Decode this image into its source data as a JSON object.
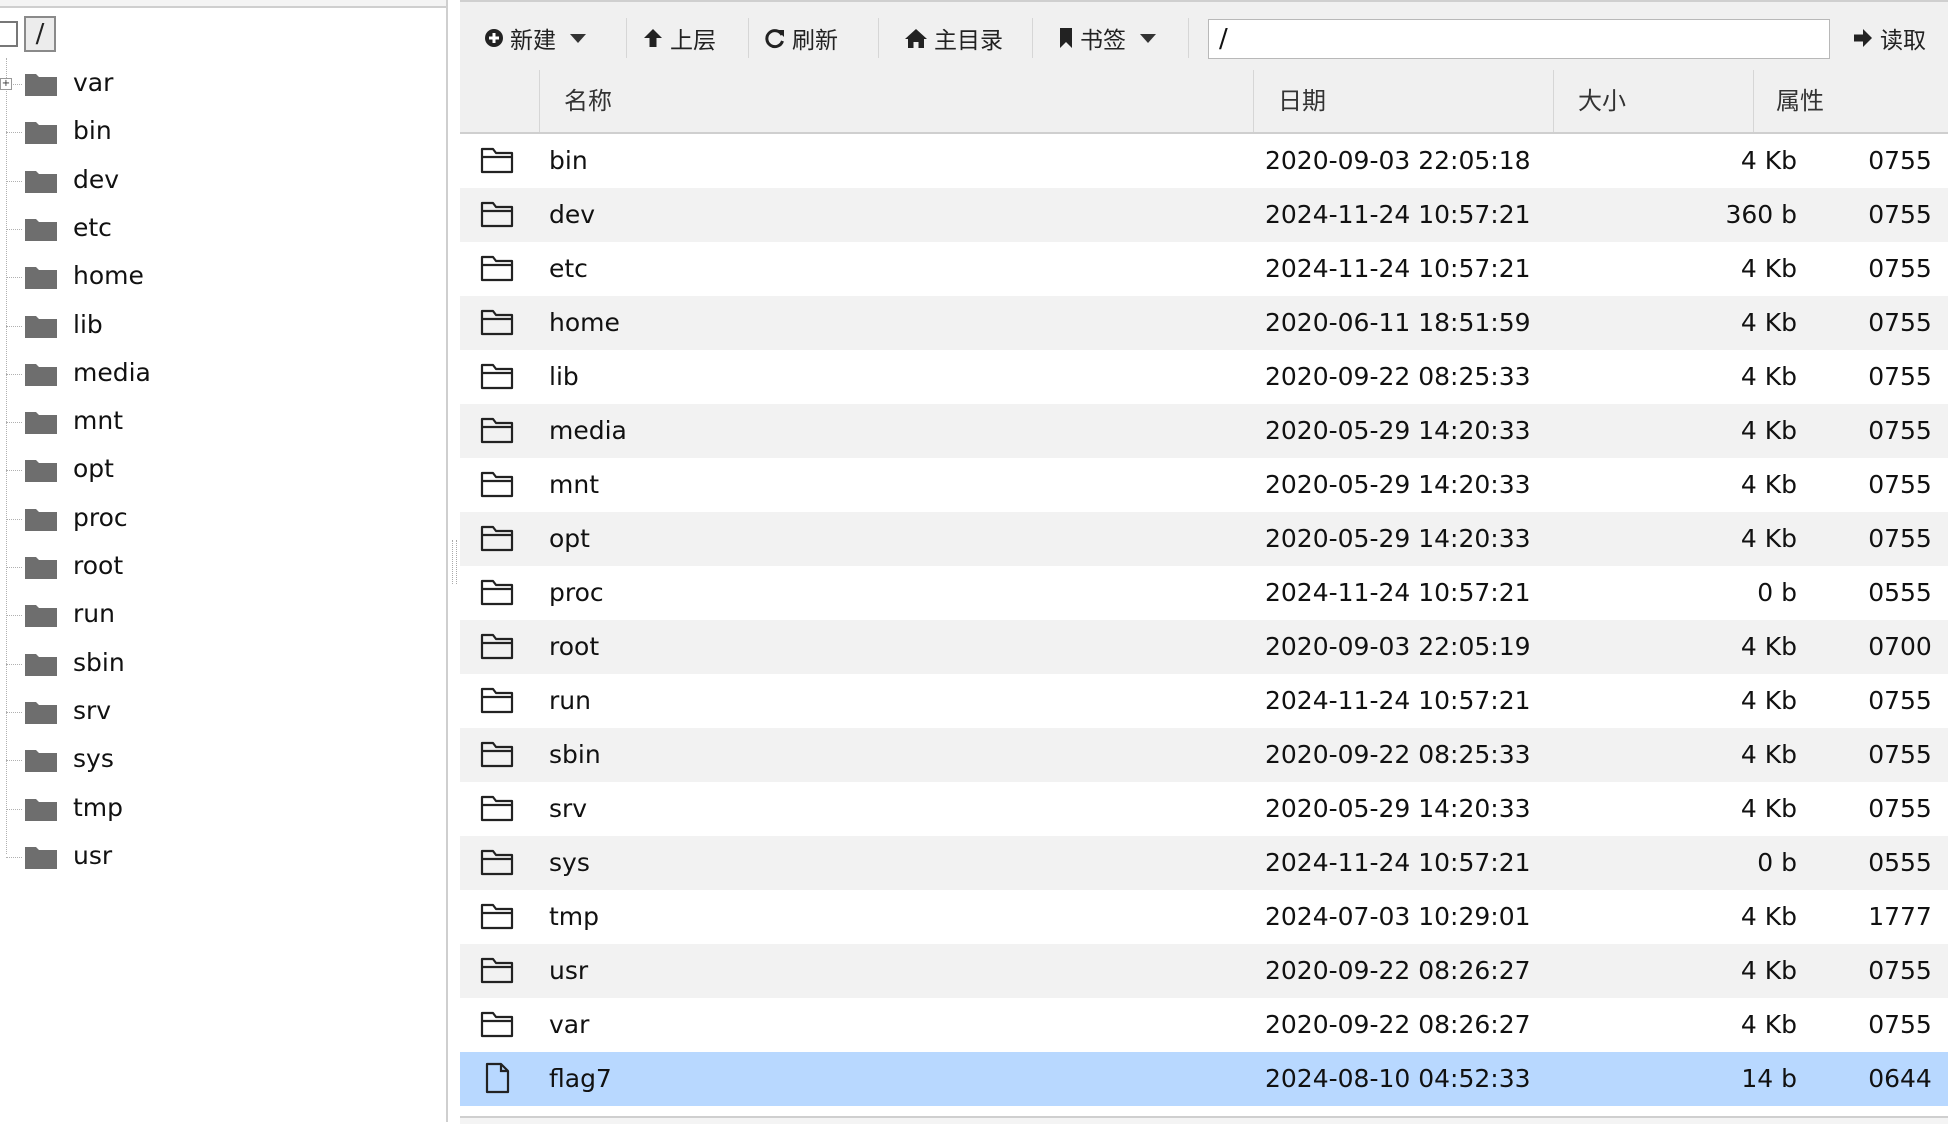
{
  "tree": {
    "root_label": "/",
    "items": [
      {
        "label": "var",
        "expandable": true
      },
      {
        "label": "bin"
      },
      {
        "label": "dev"
      },
      {
        "label": "etc"
      },
      {
        "label": "home"
      },
      {
        "label": "lib"
      },
      {
        "label": "media"
      },
      {
        "label": "mnt"
      },
      {
        "label": "opt"
      },
      {
        "label": "proc"
      },
      {
        "label": "root"
      },
      {
        "label": "run"
      },
      {
        "label": "sbin"
      },
      {
        "label": "srv"
      },
      {
        "label": "sys"
      },
      {
        "label": "tmp"
      },
      {
        "label": "usr"
      }
    ]
  },
  "toolbar": {
    "new_label": "新建",
    "up_label": "上层",
    "refresh_label": "刷新",
    "home_label": "主目录",
    "bookmark_label": "书签",
    "path_value": "/",
    "read_label": "读取"
  },
  "table": {
    "columns": {
      "name": "名称",
      "date": "日期",
      "size": "大小",
      "perm": "属性"
    },
    "rows": [
      {
        "type": "folder",
        "name": "bin",
        "date": "2020-09-03 22:05:18",
        "size": "4 Kb",
        "perm": "0755"
      },
      {
        "type": "folder",
        "name": "dev",
        "date": "2024-11-24 10:57:21",
        "size": "360 b",
        "perm": "0755"
      },
      {
        "type": "folder",
        "name": "etc",
        "date": "2024-11-24 10:57:21",
        "size": "4 Kb",
        "perm": "0755"
      },
      {
        "type": "folder",
        "name": "home",
        "date": "2020-06-11 18:51:59",
        "size": "4 Kb",
        "perm": "0755"
      },
      {
        "type": "folder",
        "name": "lib",
        "date": "2020-09-22 08:25:33",
        "size": "4 Kb",
        "perm": "0755"
      },
      {
        "type": "folder",
        "name": "media",
        "date": "2020-05-29 14:20:33",
        "size": "4 Kb",
        "perm": "0755"
      },
      {
        "type": "folder",
        "name": "mnt",
        "date": "2020-05-29 14:20:33",
        "size": "4 Kb",
        "perm": "0755"
      },
      {
        "type": "folder",
        "name": "opt",
        "date": "2020-05-29 14:20:33",
        "size": "4 Kb",
        "perm": "0755"
      },
      {
        "type": "folder",
        "name": "proc",
        "date": "2024-11-24 10:57:21",
        "size": "0 b",
        "perm": "0555"
      },
      {
        "type": "folder",
        "name": "root",
        "date": "2020-09-03 22:05:19",
        "size": "4 Kb",
        "perm": "0700"
      },
      {
        "type": "folder",
        "name": "run",
        "date": "2024-11-24 10:57:21",
        "size": "4 Kb",
        "perm": "0755"
      },
      {
        "type": "folder",
        "name": "sbin",
        "date": "2020-09-22 08:25:33",
        "size": "4 Kb",
        "perm": "0755"
      },
      {
        "type": "folder",
        "name": "srv",
        "date": "2020-05-29 14:20:33",
        "size": "4 Kb",
        "perm": "0755"
      },
      {
        "type": "folder",
        "name": "sys",
        "date": "2024-11-24 10:57:21",
        "size": "0 b",
        "perm": "0555"
      },
      {
        "type": "folder",
        "name": "tmp",
        "date": "2024-07-03 10:29:01",
        "size": "4 Kb",
        "perm": "1777"
      },
      {
        "type": "folder",
        "name": "usr",
        "date": "2020-09-22 08:26:27",
        "size": "4 Kb",
        "perm": "0755"
      },
      {
        "type": "folder",
        "name": "var",
        "date": "2020-09-22 08:26:27",
        "size": "4 Kb",
        "perm": "0755"
      },
      {
        "type": "file",
        "name": "flag7",
        "date": "2024-08-10 04:52:33",
        "size": "14 b",
        "perm": "0644",
        "selected": true
      }
    ]
  },
  "colors": {
    "selected_row": "#b8d8ff",
    "alt_row": "#f2f2f2",
    "toolbar_bg": "#f0f0f0"
  }
}
